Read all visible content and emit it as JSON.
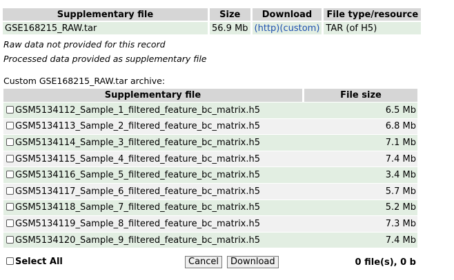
{
  "supplementary": {
    "headers": [
      "Supplementary file",
      "Size",
      "Download",
      "File type/resource"
    ],
    "row": {
      "file": "GSE168215_RAW.tar",
      "size": "56.9 Mb",
      "download_http": "(http)",
      "download_custom": "(custom)",
      "type": "TAR (of H5)"
    }
  },
  "notes": {
    "raw": "Raw data not provided for this record",
    "processed": "Processed data provided as supplementary file"
  },
  "custom_archive": {
    "label": "Custom GSE168215_RAW.tar archive:",
    "headers": [
      "Supplementary file",
      "File size"
    ],
    "rows": [
      {
        "file": "GSM5134112_Sample_1_filtered_feature_bc_matrix.h5",
        "size": "6.5 Mb"
      },
      {
        "file": "GSM5134113_Sample_2_filtered_feature_bc_matrix.h5",
        "size": "6.8 Mb"
      },
      {
        "file": "GSM5134114_Sample_3_filtered_feature_bc_matrix.h5",
        "size": "7.1 Mb"
      },
      {
        "file": "GSM5134115_Sample_4_filtered_feature_bc_matrix.h5",
        "size": "7.4 Mb"
      },
      {
        "file": "GSM5134116_Sample_5_filtered_feature_bc_matrix.h5",
        "size": "3.4 Mb"
      },
      {
        "file": "GSM5134117_Sample_6_filtered_feature_bc_matrix.h5",
        "size": "5.7 Mb"
      },
      {
        "file": "GSM5134118_Sample_7_filtered_feature_bc_matrix.h5",
        "size": "5.2 Mb"
      },
      {
        "file": "GSM5134119_Sample_8_filtered_feature_bc_matrix.h5",
        "size": "7.3 Mb"
      },
      {
        "file": "GSM5134120_Sample_9_filtered_feature_bc_matrix.h5",
        "size": "7.4 Mb"
      }
    ]
  },
  "footer": {
    "select_all_label": "Select All",
    "cancel_label": "Cancel",
    "download_label": "Download",
    "status": "0 file(s), 0 b"
  },
  "colors": {
    "header_bg": "#d6d6d6",
    "row_green": "#e2eee2",
    "row_gray": "#f1f1f1",
    "link": "#1c4fae"
  }
}
